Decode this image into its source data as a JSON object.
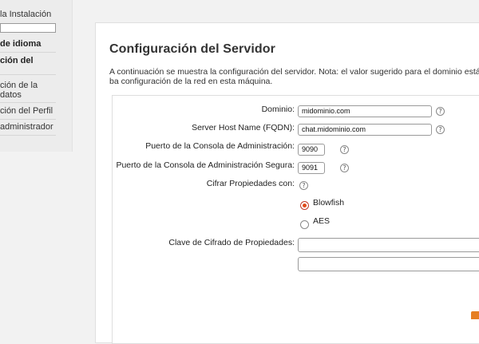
{
  "sidebar": {
    "items": [
      "la Instalación",
      "de idioma",
      "ción del",
      "ción de la",
      "datos",
      "ción del Perfil",
      "administrador"
    ]
  },
  "main": {
    "title": "Configuración del Servidor",
    "description": "A continuación se muestra la configuración del servidor. Nota: el valor sugerido para el dominio está ba configuración de la red en esta máquina."
  },
  "form": {
    "domain_label": "Dominio:",
    "domain_value": "midominio.com",
    "fqdn_label": "Server Host Name (FQDN):",
    "fqdn_value": "chat.midominio.com",
    "admin_port_label": "Puerto de la Consola de Administración:",
    "admin_port_value": "9090",
    "secure_port_label": "Puerto de la Consola de Administración Segura:",
    "secure_port_value": "9091",
    "cipher_label": "Cifrar Propiedades con:",
    "option_blowfish": "Blowfish",
    "option_aes": "AES",
    "key_label": "Clave de Cifrado de Propiedades:",
    "key_value": "",
    "key_confirm_value": "",
    "help_glyph": "?"
  },
  "colors": {
    "radio_selected": "#e04a1a",
    "accent_corner": "#e67e22"
  },
  "icons": {
    "help": "help-icon"
  }
}
